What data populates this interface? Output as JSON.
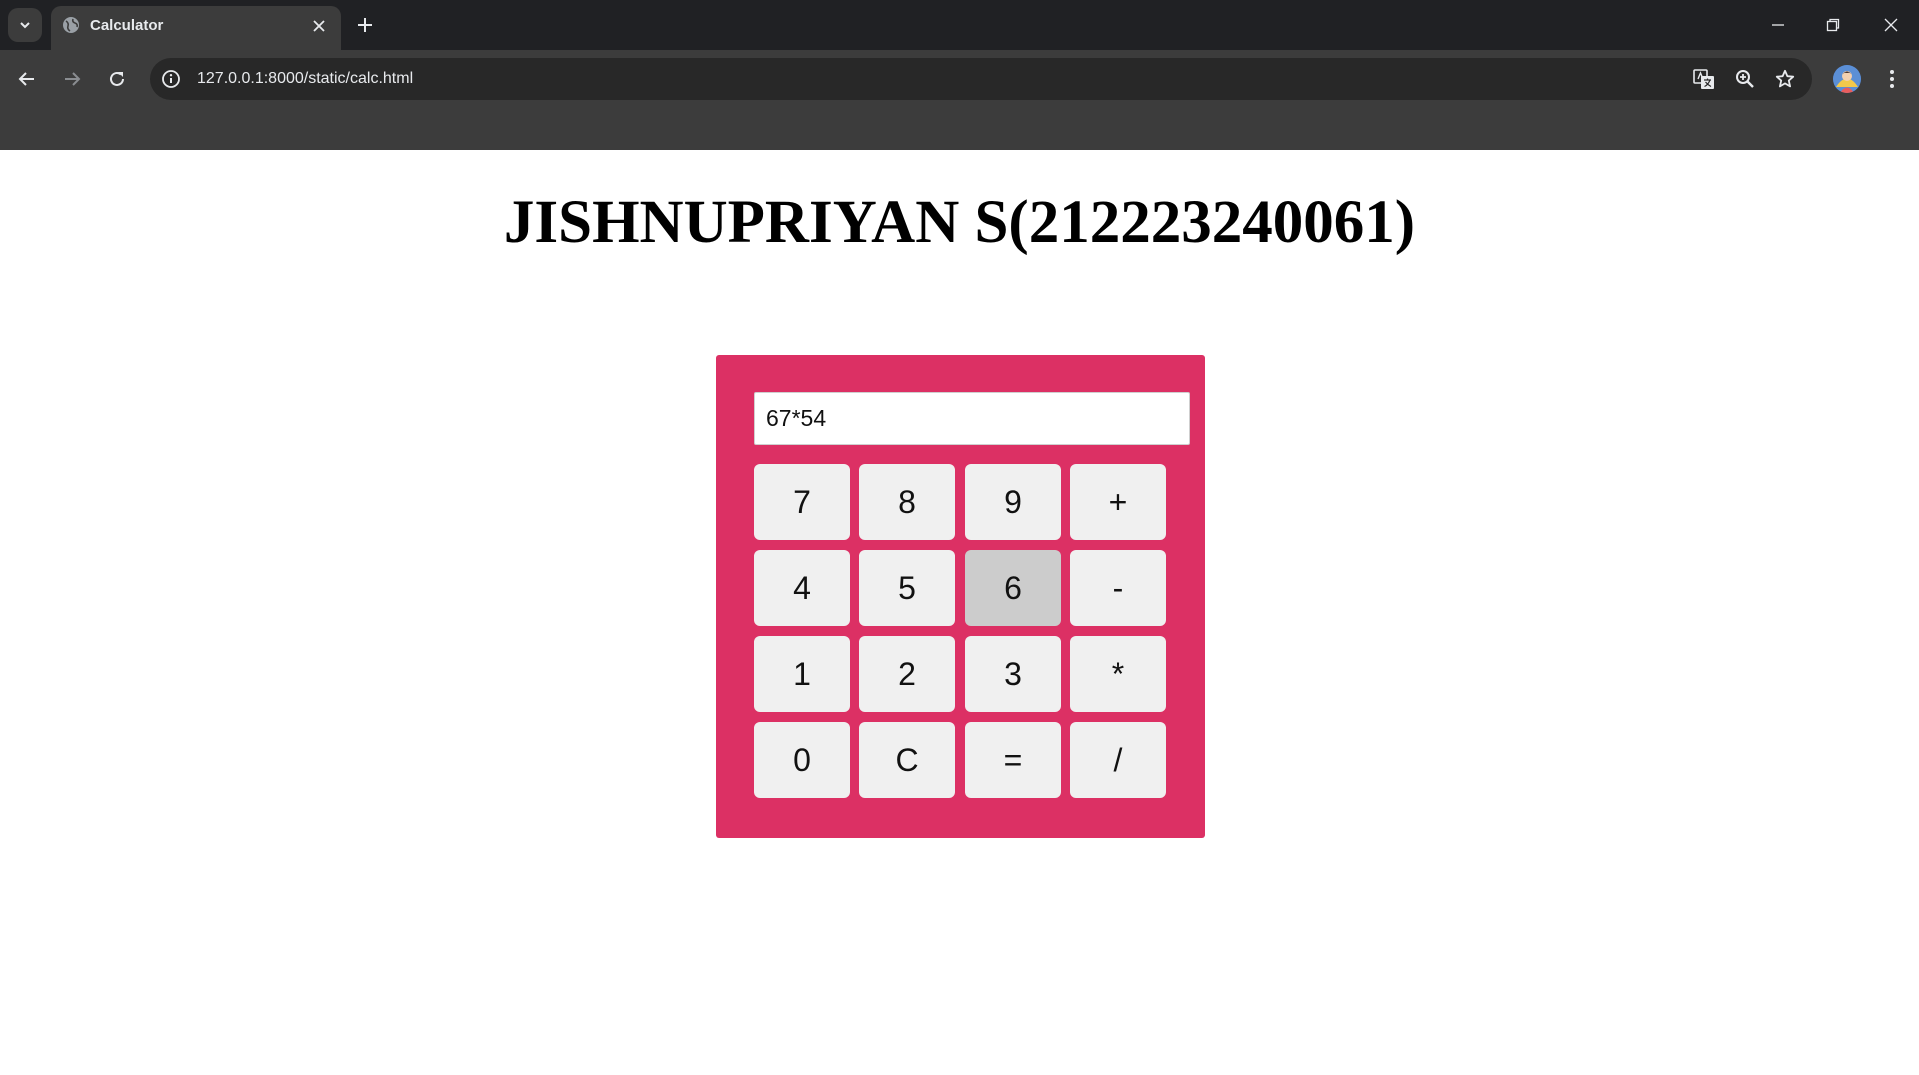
{
  "browser": {
    "tab_title": "Calculator",
    "url": "127.0.0.1:8000/static/calc.html"
  },
  "page": {
    "heading": "JISHNUPRIYAN S(212223240061)"
  },
  "calculator": {
    "display_value": "67*54",
    "accent_color": "#dc3064",
    "pressed_key": "6",
    "keys": [
      [
        "7",
        "8",
        "9",
        "+"
      ],
      [
        "4",
        "5",
        "6",
        "-"
      ],
      [
        "1",
        "2",
        "3",
        "*"
      ],
      [
        "0",
        "C",
        "=",
        "/"
      ]
    ]
  }
}
